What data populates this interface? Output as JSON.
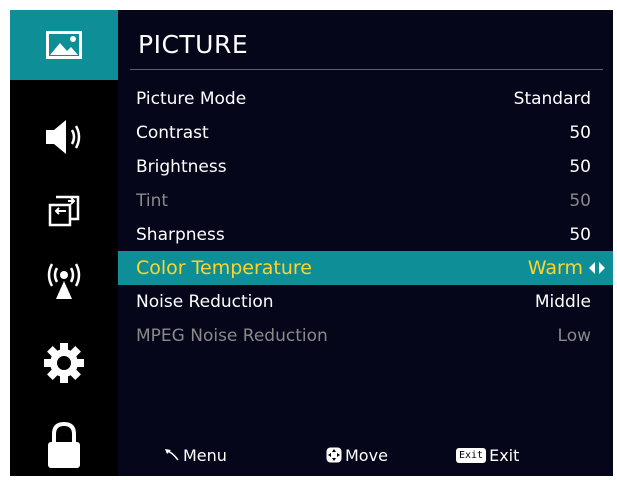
{
  "sidebar": {
    "items": [
      {
        "icon": "picture-icon",
        "active": true
      },
      {
        "icon": "sound-icon",
        "active": false
      },
      {
        "icon": "input-source-icon",
        "active": false
      },
      {
        "icon": "channel-broadcast-icon",
        "active": false
      },
      {
        "icon": "settings-gear-icon",
        "active": false
      },
      {
        "icon": "lock-icon",
        "active": false
      }
    ]
  },
  "panel": {
    "title": "PICTURE",
    "rows": [
      {
        "label": "Picture Mode",
        "value": "Standard",
        "state": "normal"
      },
      {
        "label": "Contrast",
        "value": "50",
        "state": "normal"
      },
      {
        "label": "Brightness",
        "value": "50",
        "state": "normal"
      },
      {
        "label": "Tint",
        "value": "50",
        "state": "disabled"
      },
      {
        "label": "Sharpness",
        "value": "50",
        "state": "normal"
      },
      {
        "label": "Color Temperature",
        "value": "Warm",
        "state": "selected"
      },
      {
        "label": "Noise Reduction",
        "value": "Middle",
        "state": "normal"
      },
      {
        "label": "MPEG Noise Reduction",
        "value": "Low",
        "state": "disabled"
      }
    ]
  },
  "footer": {
    "menu_label": "Menu",
    "move_label": "Move",
    "exit_key": "Exit",
    "exit_label": "Exit"
  },
  "colors": {
    "accent": "#0e8f98",
    "selected_text": "#ffd42a",
    "panel_bg": "#05061a",
    "disabled_text": "#8a8a8a"
  }
}
